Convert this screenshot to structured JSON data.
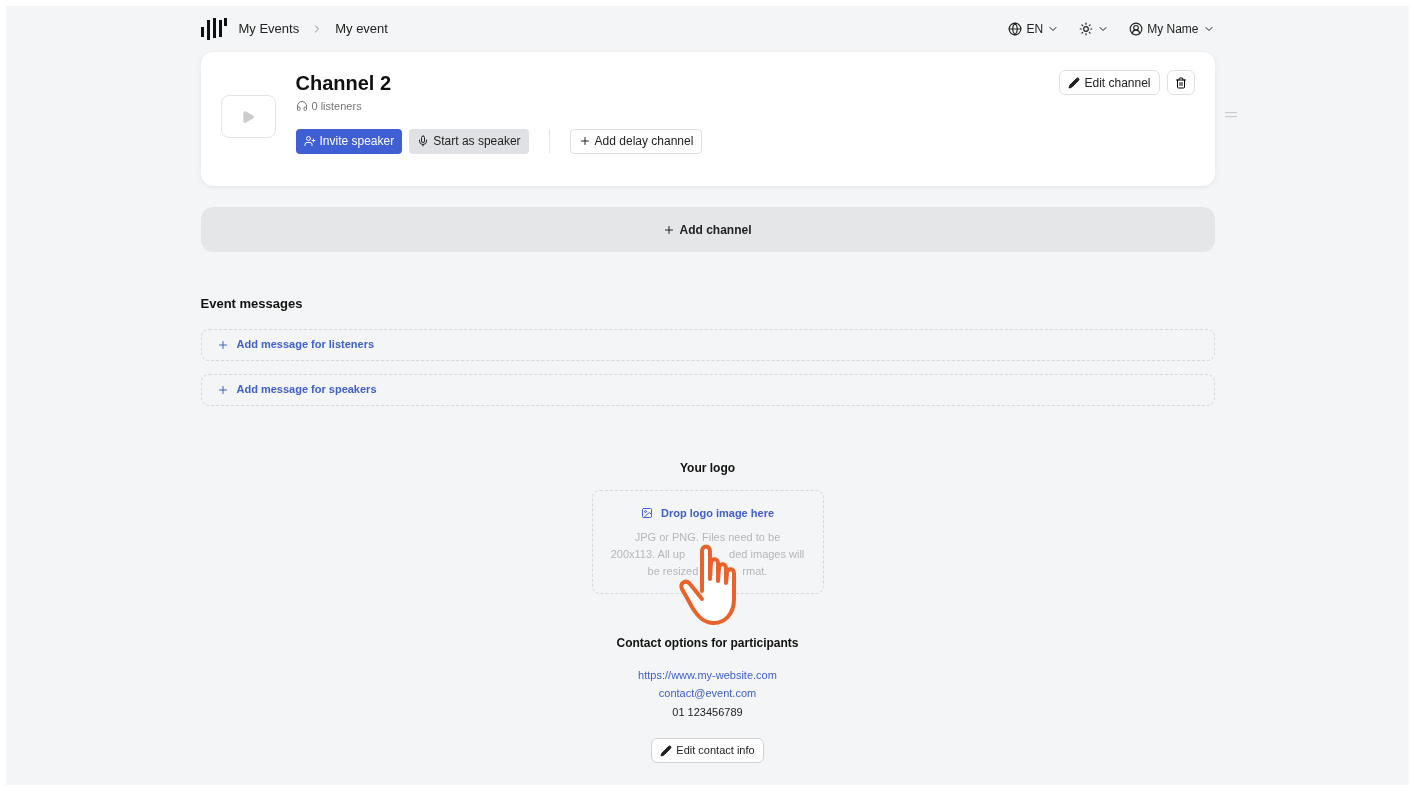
{
  "breadcrumb": [
    "My Events",
    "My event"
  ],
  "header_menus": [
    {
      "kind": "language",
      "label": "EN"
    },
    {
      "kind": "theme"
    },
    {
      "kind": "user",
      "label": "My Name"
    }
  ],
  "channel": {
    "title": "Channel 2",
    "listeners": "0 listeners",
    "invite_button": "Invite speaker",
    "start_button": "Start as speaker",
    "delay_button": "Add delay channel",
    "edit_button": "Edit channel"
  },
  "add_channel": "Add channel",
  "event_messages": {
    "title": "Event messages",
    "items": [
      "Add message for listeners",
      "Add message for speakers"
    ]
  },
  "logo": {
    "title": "Your logo",
    "drop_label": "Drop logo image here",
    "hint_lines": [
      [
        "JPG or PNG. Files need to be"
      ],
      [
        "200x113. All up",
        "ded images will"
      ],
      [
        "be resized",
        "rmat."
      ]
    ]
  },
  "contact": {
    "title": "Contact options for participants",
    "website": "https://www.my-website.com",
    "email": "contact@event.com",
    "phone": "01 123456789",
    "edit_button": "Edit contact info"
  }
}
